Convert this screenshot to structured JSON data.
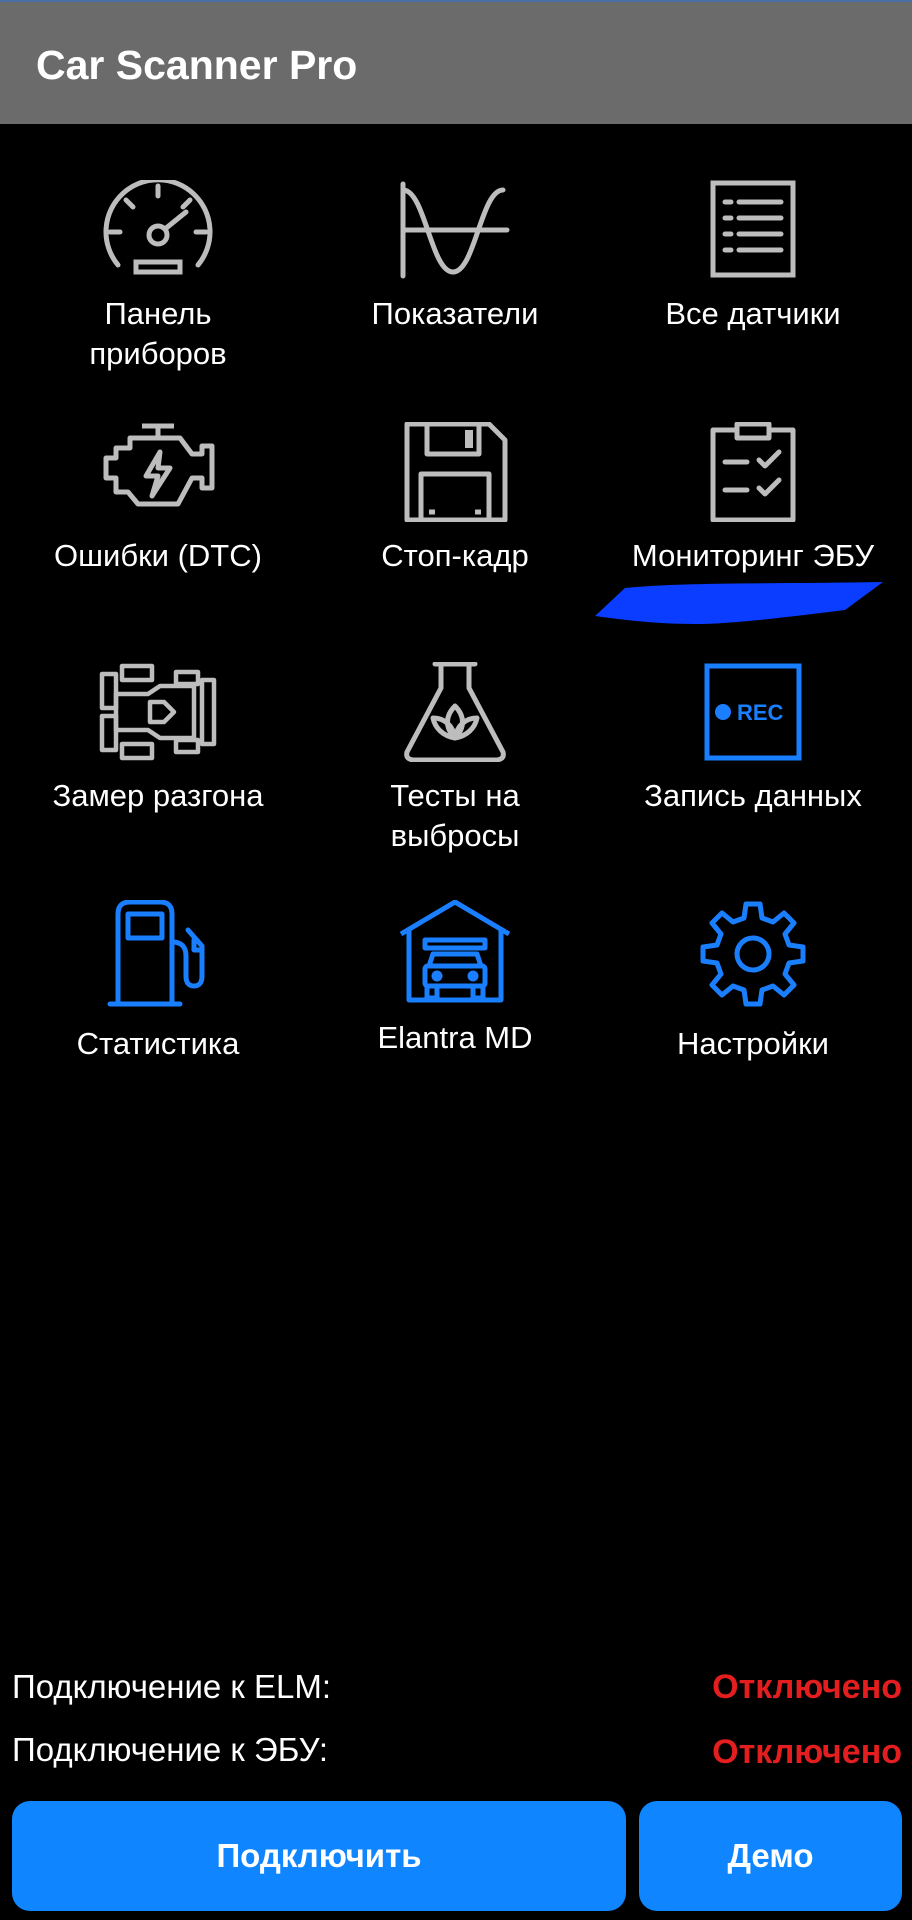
{
  "app_bar": {
    "title": "Car Scanner Pro"
  },
  "menu": {
    "items": [
      {
        "key": "dashboard",
        "label_line1": "Панель",
        "label_line2": "приборов",
        "icon": "speedometer-icon"
      },
      {
        "key": "indicators",
        "label_line1": "Показатели",
        "label_line2": "",
        "icon": "sine-wave-icon"
      },
      {
        "key": "all-sensors",
        "label_line1": "Все датчики",
        "label_line2": "",
        "icon": "list-icon"
      },
      {
        "key": "dtc",
        "label_line1": "Ошибки (DTC)",
        "label_line2": "",
        "icon": "engine-icon"
      },
      {
        "key": "freeze-frame",
        "label_line1": "Стоп-кадр",
        "label_line2": "",
        "icon": "floppy-disk-icon"
      },
      {
        "key": "ecu-monitoring",
        "label_line1": "Мониторинг ЭБУ",
        "label_line2": "",
        "icon": "clipboard-check-icon"
      },
      {
        "key": "acceleration",
        "label_line1": "Замер разгона",
        "label_line2": "",
        "icon": "race-car-icon"
      },
      {
        "key": "emission-tests",
        "label_line1": "Тесты на",
        "label_line2": "выбросы",
        "icon": "flask-leaf-icon"
      },
      {
        "key": "data-recording",
        "label_line1": "Запись данных",
        "label_line2": "",
        "icon": "rec-icon"
      },
      {
        "key": "statistics",
        "label_line1": "Статистика",
        "label_line2": "",
        "icon": "fuel-pump-icon"
      },
      {
        "key": "vehicle",
        "label_line1": "Elantra MD",
        "label_line2": "",
        "icon": "garage-car-icon"
      },
      {
        "key": "settings",
        "label_line1": "Настройки",
        "label_line2": "",
        "icon": "gear-icon"
      }
    ],
    "rec_text": "REC"
  },
  "status": {
    "elm_label": "Подключение к ELM:",
    "elm_value": "Отключено",
    "ecu_label": "Подключение к ЭБУ:",
    "ecu_value": "Отключено"
  },
  "actions": {
    "connect_label": "Подключить",
    "demo_label": "Демо"
  },
  "colors": {
    "app_bar": "#6b6b6b",
    "background": "#000000",
    "icon_gray": "#bdbdbd",
    "icon_blue": "#1a7fff",
    "status_red": "#e41e1e",
    "button_blue": "#0f86ff",
    "scribble_blue": "#0a3dff"
  }
}
